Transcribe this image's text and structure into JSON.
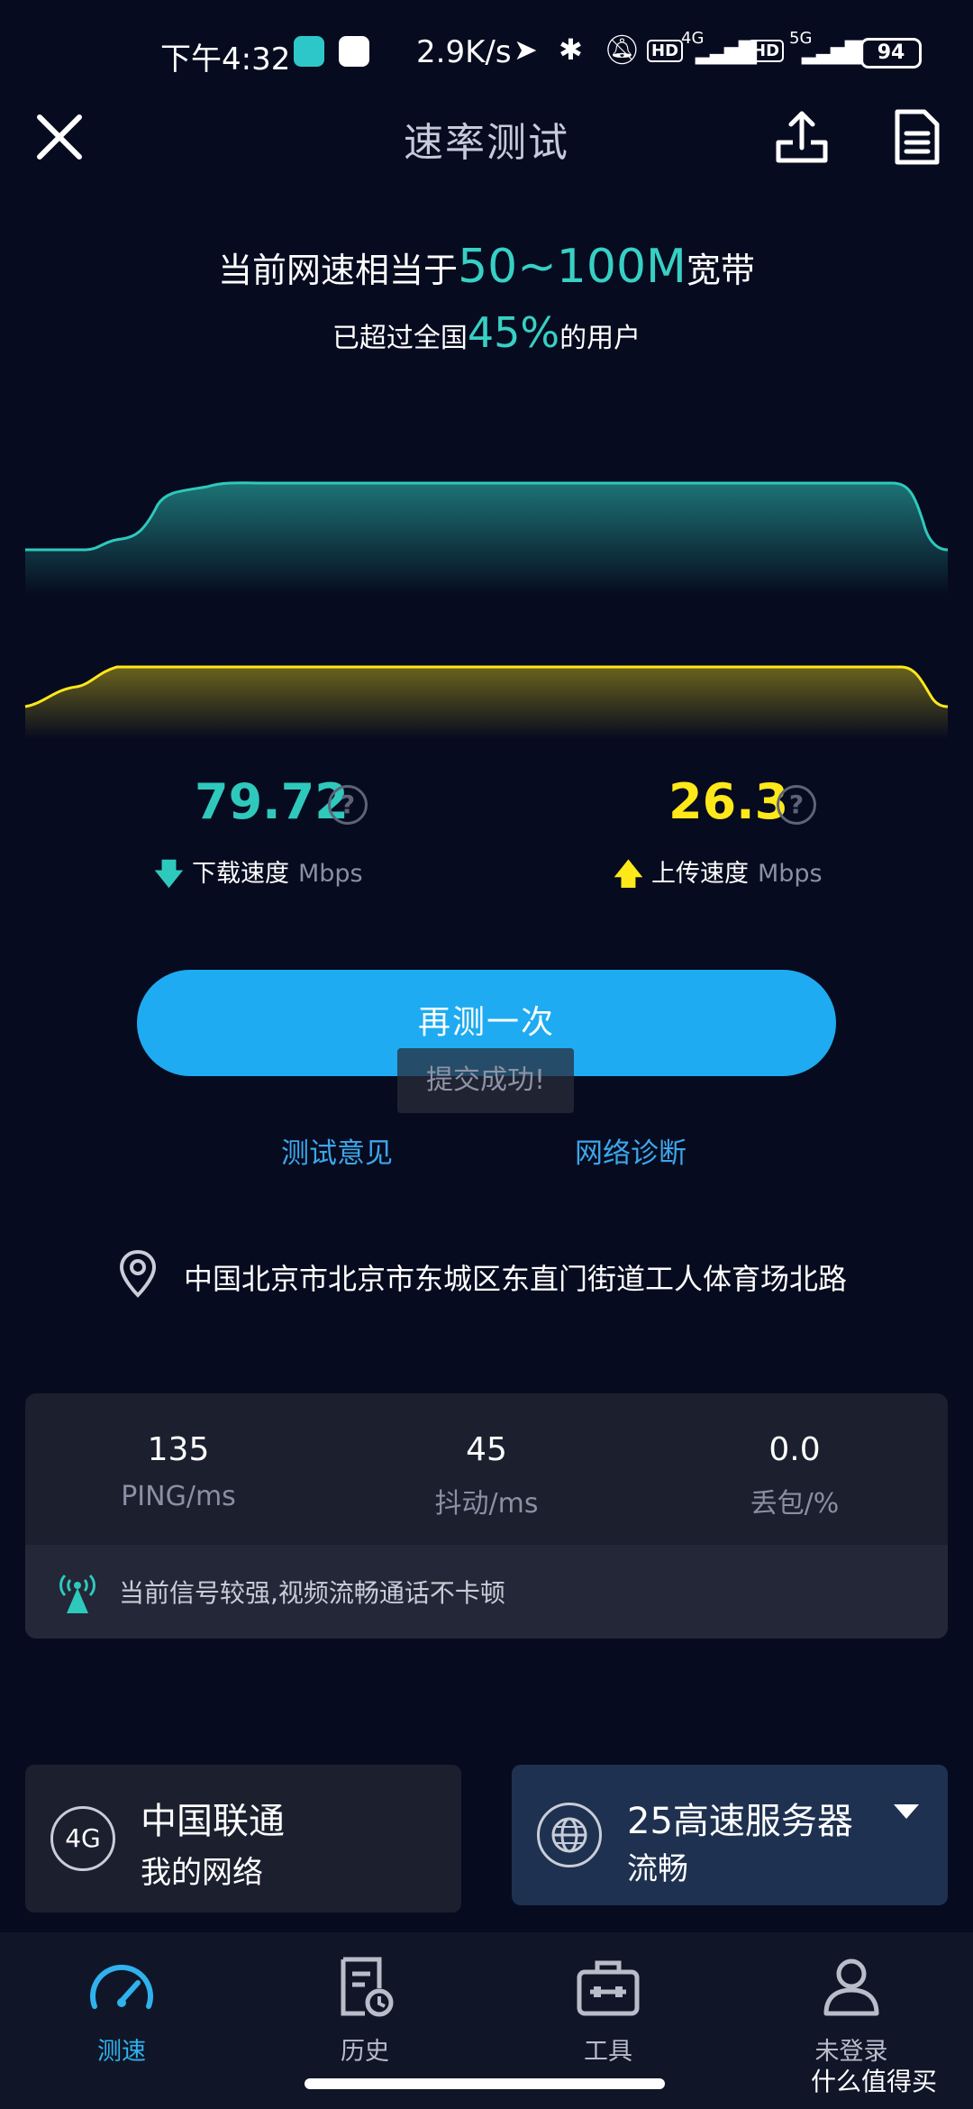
{
  "status_bar": {
    "time": "下午4:32",
    "net_speed": "2.9K/s",
    "net1": "4G",
    "net2": "5G",
    "hd": "HD",
    "battery": "94"
  },
  "header": {
    "title": "速率测试"
  },
  "summary": {
    "line1_prefix": "当前网速相当于",
    "line1_highlight": "50~100M",
    "line1_suffix": "宽带",
    "line2_prefix": "已超过全国",
    "line2_highlight": "45%",
    "line2_suffix": "的用户"
  },
  "colors": {
    "download": "#2ec9bc",
    "upload": "#ffe81a",
    "accent": "#1eabf1",
    "link": "#3ca6ea",
    "background": "#070b1f"
  },
  "download": {
    "value": "79.72",
    "label": "下载速度",
    "unit": "Mbps",
    "help": "?"
  },
  "upload": {
    "value": "26.3",
    "label": "上传速度",
    "unit": "Mbps",
    "help": "?"
  },
  "actions": {
    "retest_label": "再测一次",
    "toast": "提交成功!",
    "feedback_link": "测试意见",
    "diagnose_link": "网络诊断"
  },
  "location": {
    "address": "中国北京市北京市东城区东直门街道工人体育场北路"
  },
  "stats": [
    {
      "value": "135",
      "label": "PING/ms"
    },
    {
      "value": "45",
      "label": "抖动/ms"
    },
    {
      "value": "0.0",
      "label": "丢包/%"
    }
  ],
  "signal_message": "当前信号较强,视频流畅通话不卡顿",
  "carrier": {
    "badge": "4G",
    "name": "中国联通",
    "network": "我的网络"
  },
  "server": {
    "name": "25高速服务器",
    "quality": "流畅"
  },
  "nav": [
    {
      "label": "测速",
      "icon": "speedometer-icon",
      "active": true
    },
    {
      "label": "历史",
      "icon": "history-icon",
      "active": false
    },
    {
      "label": "工具",
      "icon": "toolbox-icon",
      "active": false
    },
    {
      "label": "未登录",
      "icon": "user-icon",
      "active": false
    }
  ],
  "watermark": "什么值得买"
}
